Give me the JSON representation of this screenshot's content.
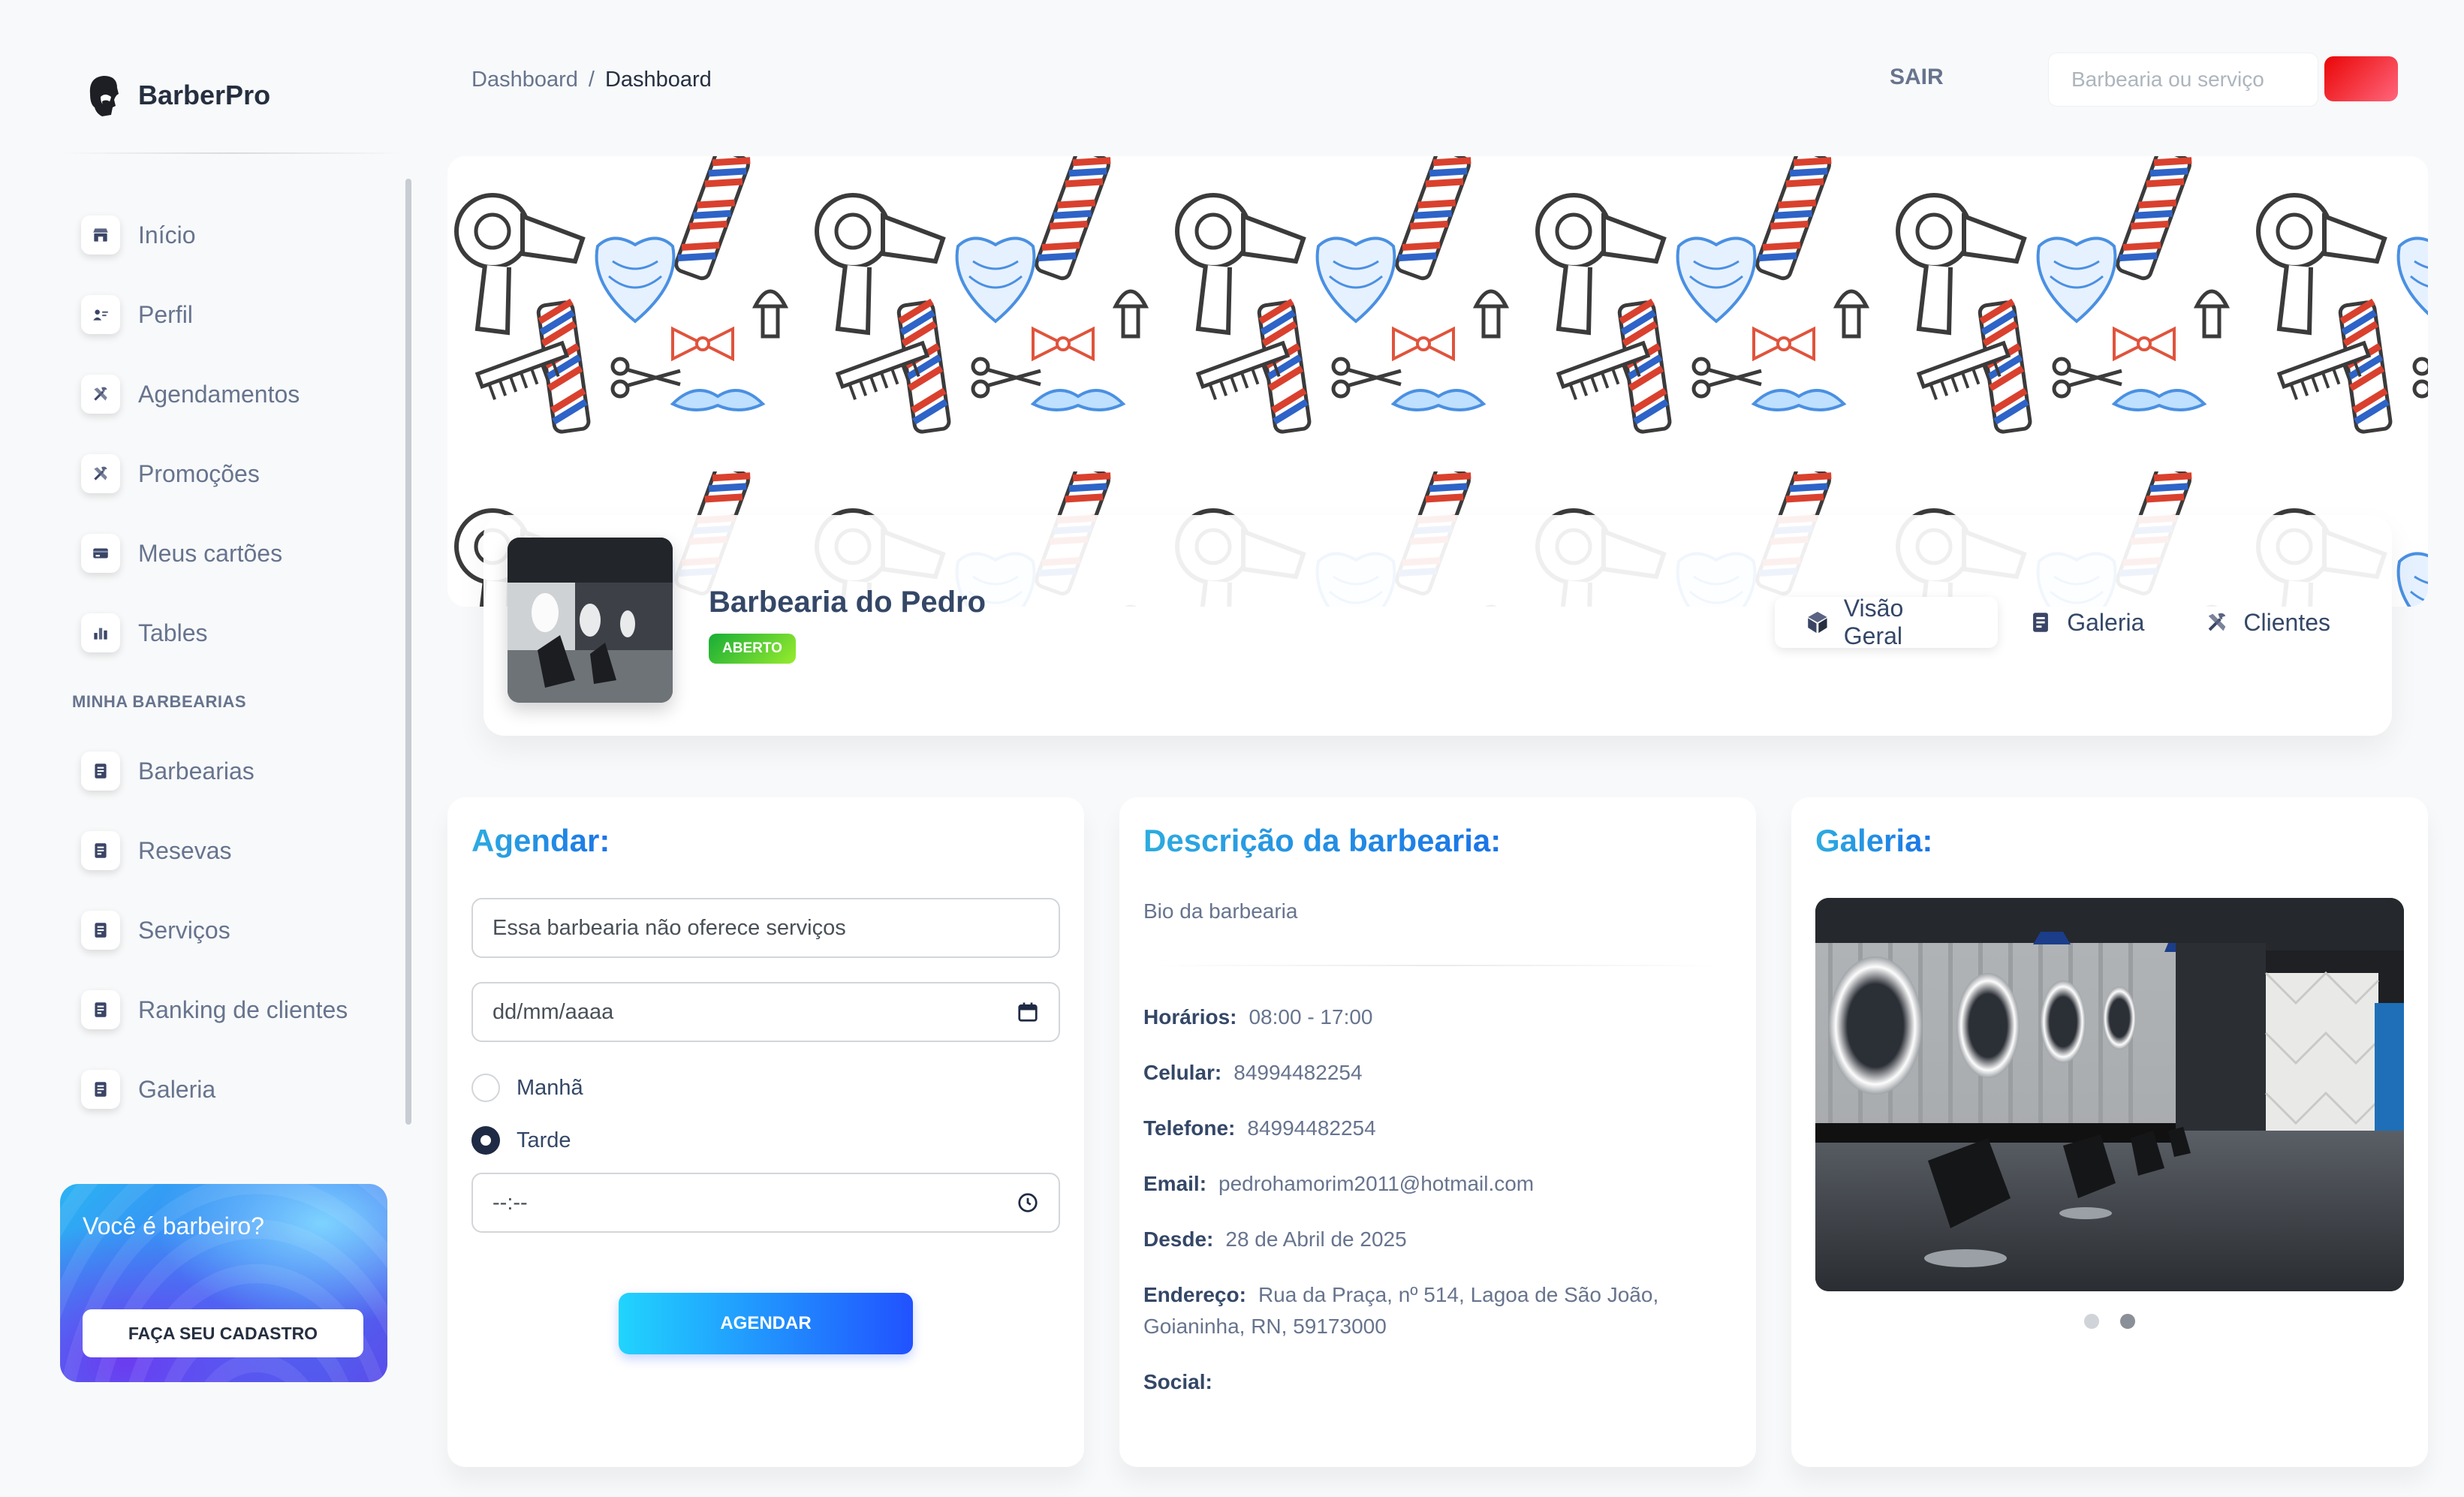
{
  "brand": {
    "name": "BarberPro"
  },
  "sidebar": {
    "items": [
      {
        "label": "Início",
        "icon": "shop-icon"
      },
      {
        "label": "Perfil",
        "icon": "user-card-icon"
      },
      {
        "label": "Agendamentos",
        "icon": "tools-icon"
      },
      {
        "label": "Promoções",
        "icon": "tools-icon"
      },
      {
        "label": "Meus cartões",
        "icon": "credit-card-icon"
      },
      {
        "label": "Tables",
        "icon": "chart-icon"
      }
    ],
    "section_title": "MINHA BARBEARIAS",
    "section_items": [
      {
        "label": "Barbearias",
        "icon": "document-icon"
      },
      {
        "label": "Resevas",
        "icon": "document-icon"
      },
      {
        "label": "Serviços",
        "icon": "document-icon"
      },
      {
        "label": "Ranking de clientes",
        "icon": "document-icon"
      },
      {
        "label": "Galeria",
        "icon": "document-icon"
      }
    ],
    "promo": {
      "title": "Você é barbeiro?",
      "button": "FAÇA SEU CADASTRO"
    }
  },
  "header": {
    "breadcrumb": [
      "Dashboard",
      "/",
      "Dashboard"
    ],
    "logout": "SAIR",
    "search_placeholder": "Barbearia ou serviço"
  },
  "profile": {
    "name": "Barbearia do Pedro",
    "status": "ABERTO",
    "tabs": [
      {
        "label": "Visão Geral",
        "icon": "cube-icon",
        "active": true
      },
      {
        "label": "Galeria",
        "icon": "document-icon",
        "active": false
      },
      {
        "label": "Clientes",
        "icon": "tools-icon",
        "active": false
      }
    ]
  },
  "schedule": {
    "title": "Agendar:",
    "service_select": "Essa barbearia não oferece serviços",
    "date_placeholder": "dd/mm/aaaa",
    "shift_morning": "Manhã",
    "shift_afternoon": "Tarde",
    "selected_shift": "Tarde",
    "time_placeholder": "--:--",
    "submit": "AGENDAR"
  },
  "description": {
    "title": "Descrição da barbearia:",
    "bio": "Bio da barbearia",
    "fields": [
      {
        "label": "Horários:",
        "value": "08:00 - 17:00"
      },
      {
        "label": "Celular:",
        "value": "84994482254"
      },
      {
        "label": "Telefone:",
        "value": "84994482254"
      },
      {
        "label": "Email:",
        "value": "pedrohamorim2011@hotmail.com"
      },
      {
        "label": "Desde:",
        "value": "28 de Abril de 2025"
      },
      {
        "label": "Endereço:",
        "value": "Rua da Praça, nº 514, Lagoa de São João, Goianinha, RN, 59173000"
      },
      {
        "label": "Social:",
        "value": ""
      }
    ]
  },
  "gallery": {
    "title": "Galeria:",
    "slides": 2,
    "active_slide": 2
  },
  "colors": {
    "accent": "#1a73e8",
    "status_green": "#17ad37",
    "danger": "#ea0606",
    "text": "#344767",
    "muted": "#67748e"
  }
}
